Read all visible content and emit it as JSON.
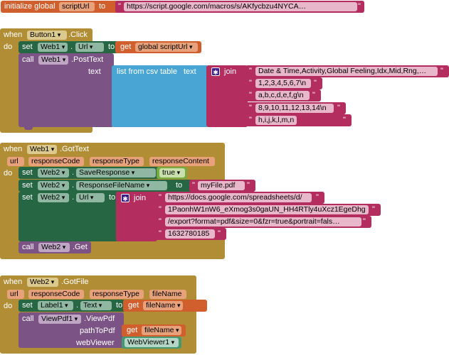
{
  "init": {
    "initialize_global": "initialize global",
    "var_name": "scriptUrl",
    "to": "to",
    "url_value": "https://script.google.com/macros/s/AKfycbzu4NYCA…"
  },
  "ev1": {
    "when": "when",
    "component": "Button1",
    "event": ".Click",
    "do": "do",
    "set": "set",
    "web1": "Web1",
    "dot": ".",
    "prop": "Url",
    "to": "to",
    "get": "get",
    "get_var": "global scriptUrl",
    "call": "call",
    "call_comp": "Web1",
    "method": ".PostText",
    "text_param": "text",
    "list_from_csv": "list from csv table",
    "text_param2": "text",
    "join": "join",
    "strings": [
      "Date & Time,Activity,Global Feeling,Idx,Mid,Rng,…",
      "1,2,3,4,5,6,7\\n",
      "a,b,c,d,e,f,g\\n",
      "8,9,10,11,12,13,14\\n",
      "h,i,j,k,l,m,n"
    ]
  },
  "ev2": {
    "when": "when",
    "component": "Web1",
    "event": ".GotText",
    "params": [
      "url",
      "responseCode",
      "responseType",
      "responseContent"
    ],
    "do": "do",
    "set": "set",
    "comp": "Web2",
    "dot": ".",
    "prop1": "SaveResponse",
    "to": "to",
    "true_val": "true",
    "prop2": "ResponseFileName",
    "file_value": "myFile.pdf",
    "prop3": "Url",
    "join": "join",
    "strings": [
      "https://docs.google.com/spreadsheets/d/",
      "1PaonhW1nW6_eXmog3s0gaUN_HH4RTly4uXcz1EgeDhg",
      "/export?format=pdf&size=0&fzr=true&portrait=fals…",
      "1632780185"
    ],
    "call": "call",
    "call_comp": "Web2",
    "method": ".Get"
  },
  "ev3": {
    "when": "when",
    "component": "Web2",
    "event": ".GotFile",
    "params": [
      "url",
      "responseCode",
      "responseType",
      "fileName"
    ],
    "do": "do",
    "set": "set",
    "comp": "Label1",
    "dot": ".",
    "prop": "Text",
    "to": "to",
    "get": "get",
    "get_var": "fileName",
    "call": "call",
    "call_comp": "ViewPdf1",
    "method": ".ViewPdf",
    "path_label": "pathToPdf",
    "get2": "get",
    "get_var2": "fileName",
    "viewer_label": "webViewer",
    "viewer_comp": "WebViewer1"
  },
  "colors": {
    "variable": "#d05f2d",
    "text": "#b32d5e",
    "event": "#b18e35",
    "setter": "#266643",
    "procedure": "#7c5385",
    "list": "#49a6d4",
    "logic": "#77ab41",
    "component": "#439970"
  }
}
